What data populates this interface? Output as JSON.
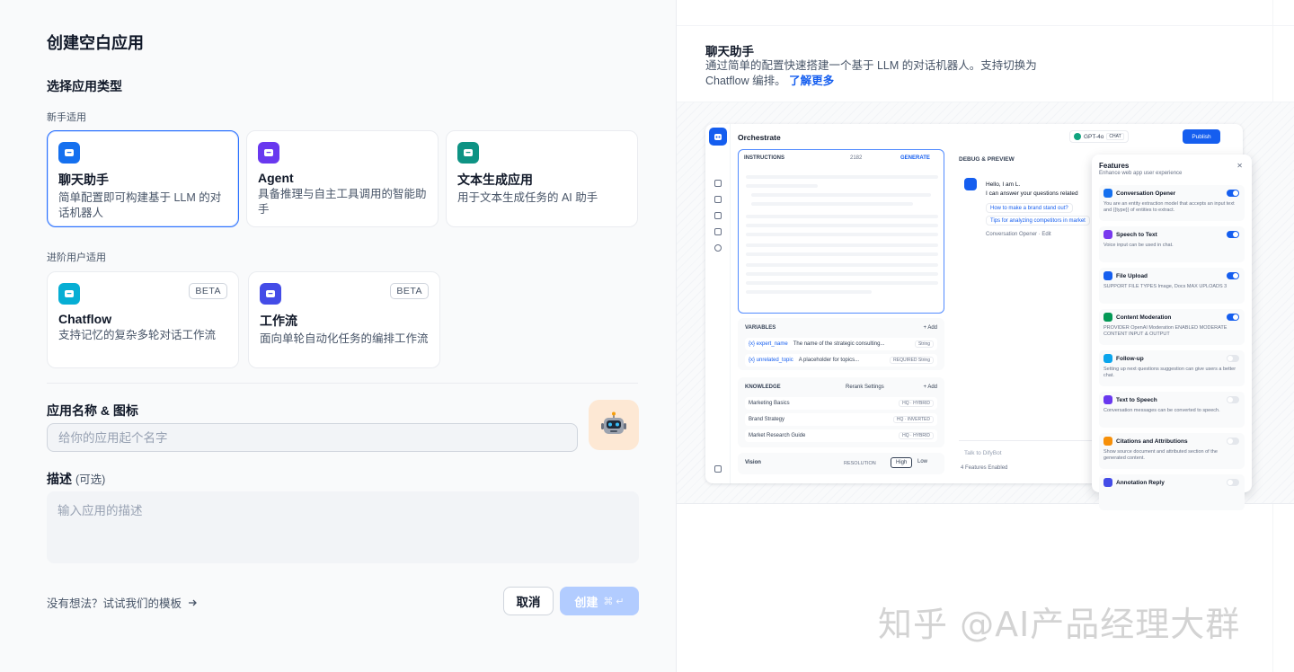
{
  "dialog": {
    "title": "创建空白应用",
    "section_title": "选择应用类型",
    "group_beginner": "新手适用",
    "group_advanced": "进阶用户适用",
    "cards_beginner": [
      {
        "name": "聊天助手",
        "desc": "简单配置即可构建基于 LLM 的对话机器人",
        "color": "#1570ef",
        "icon": "chat-bot-icon",
        "selected": true
      },
      {
        "name": "Agent",
        "desc": "具备推理与自主工具调用的智能助手",
        "color": "#6938ef",
        "icon": "agent-icon"
      },
      {
        "name": "文本生成应用",
        "desc": "用于文本生成任务的 AI 助手",
        "color": "#0e9384",
        "icon": "text-generation-icon"
      }
    ],
    "cards_advanced": [
      {
        "name": "Chatflow",
        "desc": "支持记忆的复杂多轮对话工作流",
        "badge": "BETA",
        "color": "#06aed4",
        "icon": "chatflow-icon"
      },
      {
        "name": "工作流",
        "desc": "面向单轮自动化任务的编排工作流",
        "badge": "BETA",
        "color": "#444ce7",
        "icon": "workflow-icon"
      }
    ],
    "name_label": "应用名称 & 图标",
    "name_placeholder": "给你的应用起个名字",
    "desc_label": "描述",
    "desc_optional": "(可选)",
    "desc_placeholder": "输入应用的描述",
    "template_link": "没有想法？试试我们的模板",
    "cancel": "取消",
    "create": "创建",
    "create_shortcut": "⌘ ↵"
  },
  "preview": {
    "title": "聊天助手",
    "desc": "通过简单的配置快速搭建一个基于 LLM 的对话机器人。支持切换为 Chatflow 编排。",
    "learn_more": "了解更多",
    "app": {
      "header": "Orchestrate",
      "model": "GPT-4o",
      "model_tag": "CHAT",
      "publish": "Publish",
      "instructions": "INSTRUCTIONS",
      "count": "2182",
      "generate": "GENERATE",
      "variables": "VARIABLES",
      "add": "+ Add",
      "vars": [
        {
          "key": "{x} expert_name",
          "desc": "The name of the strategic consulting...",
          "tag": "String"
        },
        {
          "key": "{x} unrelated_topic",
          "desc": "A placeholder for topics...",
          "tag": "REQUIRED  String"
        }
      ],
      "knowledge": "KNOWLEDGE",
      "rerank": "Rerank Settings",
      "docs": [
        {
          "name": "Marketing Basics",
          "tag": "HQ · HYBRID"
        },
        {
          "name": "Brand Strategy",
          "tag": "HQ · INVERTED"
        },
        {
          "name": "Market Research Guide",
          "tag": "HQ · HYBRID"
        }
      ],
      "vision": "Vision",
      "resolution": "RESOLUTION",
      "high": "High",
      "low": "Low",
      "debug": "DEBUG & PREVIEW",
      "greeting_1": "Hello, I am L.",
      "greeting_2": "I can answer your questions related",
      "sugg_1": "How to make a brand stand out?",
      "sugg_2": "Tips for analyzing competitors in market",
      "opener": "Conversation Opener · Edit",
      "chat_placeholder": "Talk to DifyBot",
      "features_enabled": "4 Features Enabled",
      "features_title": "Features",
      "features_sub": "Enhance web app user experience",
      "features": [
        {
          "name": "Conversation Opener",
          "desc": "You are an entity extraction model that accepts an input text and {{type}} of entities to extract.",
          "on": true,
          "color": "#1570ef"
        },
        {
          "name": "Speech to Text",
          "desc": "Voice input can be used in chat.",
          "on": true,
          "color": "#7839ee"
        },
        {
          "name": "File Upload",
          "desc": "SUPPORT FILE TYPES Image, Docs   MAX UPLOADS 3",
          "on": true,
          "color": "#155eef"
        },
        {
          "name": "Content Moderation",
          "desc": "PROVIDER OpenAI Moderation   ENABLED MODERATE CONTENT INPUT & OUTPUT",
          "on": true,
          "color": "#039855"
        },
        {
          "name": "Follow-up",
          "desc": "Setting up next questions suggestion can give users a better chat.",
          "on": false,
          "color": "#0ba5ec"
        },
        {
          "name": "Text to Speech",
          "desc": "Conversation messages can be converted to speech.",
          "on": false,
          "color": "#6938ef"
        },
        {
          "name": "Citations and Attributions",
          "desc": "Show source document and attributed section of the generated content.",
          "on": false,
          "color": "#f79009"
        },
        {
          "name": "Annotation Reply",
          "desc": "",
          "on": false,
          "color": "#444ce7"
        }
      ]
    }
  },
  "watermark": "知乎 @AI产品经理大群"
}
